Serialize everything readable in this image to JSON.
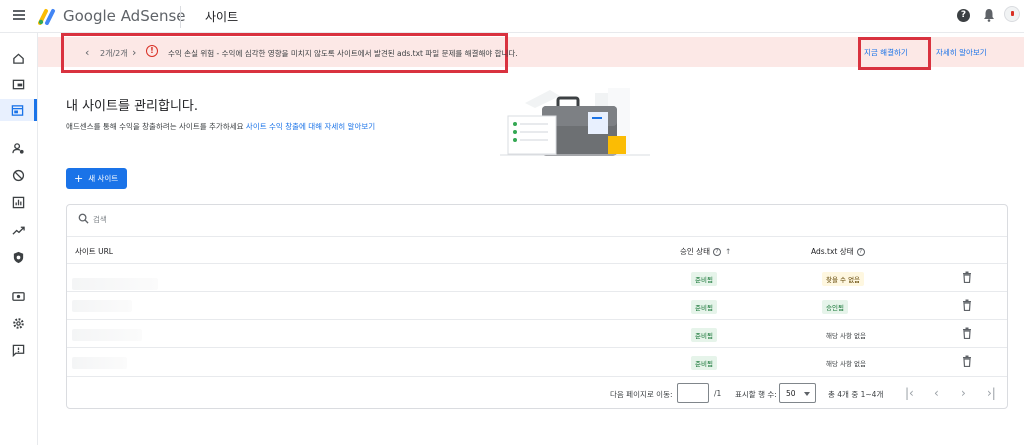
{
  "header": {
    "brand_google": "Google",
    "brand_product": "AdSense",
    "page_title": "사이트",
    "help_label": "?"
  },
  "banner": {
    "count": "2개/2개",
    "message": "수익 손실 위험 - 수익에 심각한 영향을 미치지 않도록 사이트에서 발견된 ads.txt 파일 문제를 해결해야 합니다.",
    "fix_label": "지금 해결하기",
    "learn_label": "자세히 알아보기",
    "highlight_color": "#d9323f",
    "bg_color": "#fce8e6"
  },
  "main": {
    "heading": "내 사이트를 관리합니다.",
    "subtext": "애드센스를 통해 수익을 창출하려는 사이트를 추가하세요",
    "subtext_link": "사이트 수익 창출에 대해 자세히 알아보기",
    "new_site_label": "새 사이트"
  },
  "table": {
    "search_placeholder": "검색",
    "columns": [
      "사이트 URL",
      "승인 상태",
      "Ads.txt 상태"
    ],
    "rows": [
      {
        "approval": "준비됨",
        "ads_txt": "찾을 수 없음"
      },
      {
        "approval": "준비됨",
        "ads_txt": "승인됨"
      },
      {
        "approval": "준비됨",
        "ads_txt": "해당 사항 없음"
      },
      {
        "approval": "준비됨",
        "ads_txt": "해당 사항 없음"
      }
    ]
  },
  "pagination": {
    "goto_label": "다음 페이지로 이동:",
    "goto_suffix": "/1",
    "rows_label": "표시할 행 수:",
    "rows_value": "50",
    "range_label": "총 4개 중 1~4개"
  },
  "colors": {
    "accent": "#1a73e8",
    "success": "#137333",
    "warning_badge": "#fef7e0"
  }
}
